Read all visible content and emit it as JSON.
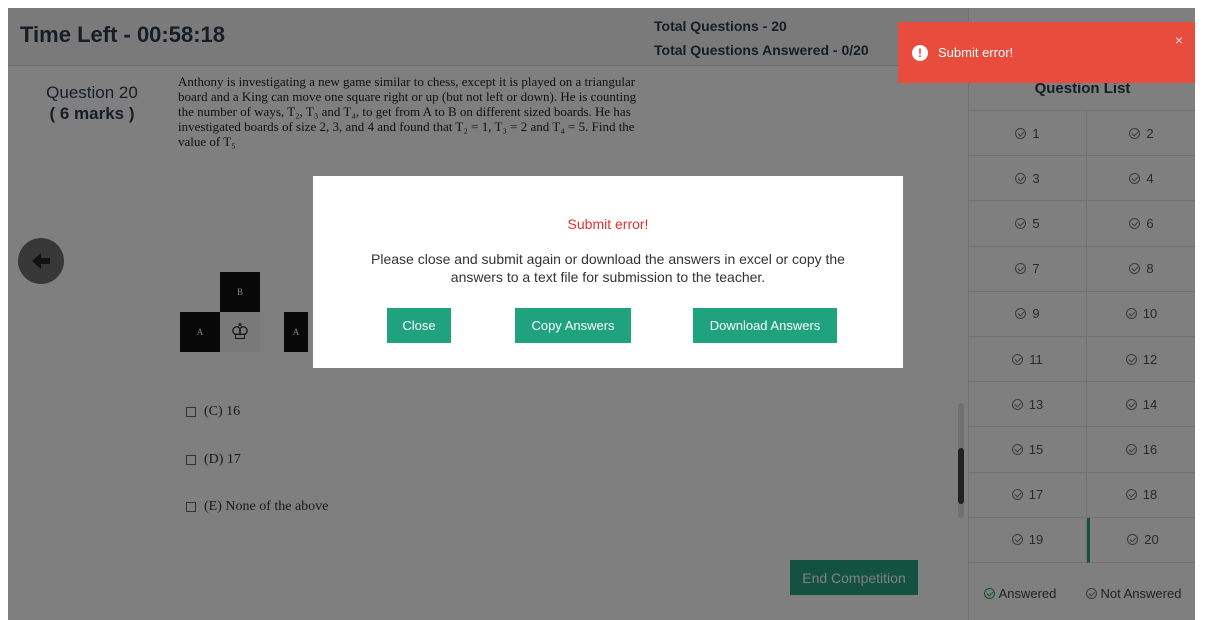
{
  "header": {
    "time_left": "Time Left - 00:58:18",
    "total_questions": "Total Questions - 20",
    "total_answered": "Total Questions Answered - 0/20"
  },
  "question": {
    "label": "Question 20",
    "marks": "( 6 marks )",
    "text": "Anthony is investigating a new game similar to chess, except it is played on a triangular board and a King can move one square right or up (but not left or down). He is counting the number of ways, T₂, T₃ and T₄, to get from A to B on different sized boards. He has investigated boards of size 2, 3, and 4 and found that T₂ = 1, T₃ = 2 and T₄ = 5. Find the value of T₅",
    "board_labels": {
      "a1": "A",
      "b": "B",
      "a2": "A",
      "king": "♔"
    },
    "options": [
      {
        "label": "(C) 16"
      },
      {
        "label": "(D) 17"
      },
      {
        "label": "(E) None of the above"
      }
    ]
  },
  "end_button": "End Competition",
  "question_list": {
    "title": "Question List",
    "items": [
      "1",
      "2",
      "3",
      "4",
      "5",
      "6",
      "7",
      "8",
      "9",
      "10",
      "11",
      "12",
      "13",
      "14",
      "15",
      "16",
      "17",
      "18",
      "19",
      "20"
    ],
    "current": "20",
    "legend_answered": "Answered",
    "legend_not_answered": "Not Answered"
  },
  "modal": {
    "title": "Submit error!",
    "message": "Please close and submit again or download the answers in excel or copy the answers to a text file for submission to the teacher.",
    "close_label": "Close",
    "copy_label": "Copy Answers",
    "download_label": "Download Answers"
  },
  "toast": {
    "icon": "!",
    "text": "Submit error!",
    "close": "×"
  },
  "colors": {
    "accent": "#27a580",
    "error": "#e74c3c",
    "error_text": "#e0312f"
  }
}
